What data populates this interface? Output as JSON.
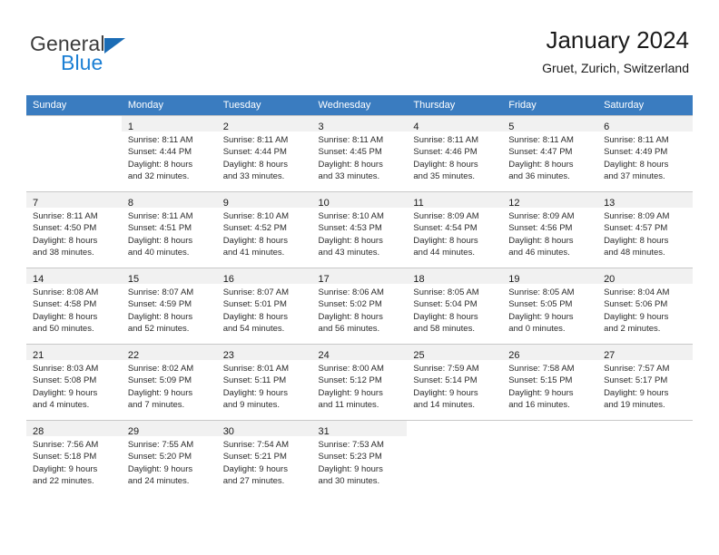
{
  "brand": {
    "line1": "General",
    "line2": "Blue",
    "triangle_color": "#1b6cb5",
    "blue_text_color": "#1b7fd4"
  },
  "header": {
    "title": "January 2024",
    "subtitle": "Gruet, Zurich, Switzerland"
  },
  "theme": {
    "header_row_bg": "#3a7cc0",
    "header_row_text": "#ffffff",
    "daynum_bar_bg": "#f1f1f1",
    "cell_border": "#c8c8c8"
  },
  "weekday_headers": [
    "Sunday",
    "Monday",
    "Tuesday",
    "Wednesday",
    "Thursday",
    "Friday",
    "Saturday"
  ],
  "weeks": [
    [
      {
        "day": "",
        "lines": []
      },
      {
        "day": "1",
        "lines": [
          "Sunrise: 8:11 AM",
          "Sunset: 4:44 PM",
          "Daylight: 8 hours",
          "and 32 minutes."
        ]
      },
      {
        "day": "2",
        "lines": [
          "Sunrise: 8:11 AM",
          "Sunset: 4:44 PM",
          "Daylight: 8 hours",
          "and 33 minutes."
        ]
      },
      {
        "day": "3",
        "lines": [
          "Sunrise: 8:11 AM",
          "Sunset: 4:45 PM",
          "Daylight: 8 hours",
          "and 33 minutes."
        ]
      },
      {
        "day": "4",
        "lines": [
          "Sunrise: 8:11 AM",
          "Sunset: 4:46 PM",
          "Daylight: 8 hours",
          "and 35 minutes."
        ]
      },
      {
        "day": "5",
        "lines": [
          "Sunrise: 8:11 AM",
          "Sunset: 4:47 PM",
          "Daylight: 8 hours",
          "and 36 minutes."
        ]
      },
      {
        "day": "6",
        "lines": [
          "Sunrise: 8:11 AM",
          "Sunset: 4:49 PM",
          "Daylight: 8 hours",
          "and 37 minutes."
        ]
      }
    ],
    [
      {
        "day": "7",
        "lines": [
          "Sunrise: 8:11 AM",
          "Sunset: 4:50 PM",
          "Daylight: 8 hours",
          "and 38 minutes."
        ]
      },
      {
        "day": "8",
        "lines": [
          "Sunrise: 8:11 AM",
          "Sunset: 4:51 PM",
          "Daylight: 8 hours",
          "and 40 minutes."
        ]
      },
      {
        "day": "9",
        "lines": [
          "Sunrise: 8:10 AM",
          "Sunset: 4:52 PM",
          "Daylight: 8 hours",
          "and 41 minutes."
        ]
      },
      {
        "day": "10",
        "lines": [
          "Sunrise: 8:10 AM",
          "Sunset: 4:53 PM",
          "Daylight: 8 hours",
          "and 43 minutes."
        ]
      },
      {
        "day": "11",
        "lines": [
          "Sunrise: 8:09 AM",
          "Sunset: 4:54 PM",
          "Daylight: 8 hours",
          "and 44 minutes."
        ]
      },
      {
        "day": "12",
        "lines": [
          "Sunrise: 8:09 AM",
          "Sunset: 4:56 PM",
          "Daylight: 8 hours",
          "and 46 minutes."
        ]
      },
      {
        "day": "13",
        "lines": [
          "Sunrise: 8:09 AM",
          "Sunset: 4:57 PM",
          "Daylight: 8 hours",
          "and 48 minutes."
        ]
      }
    ],
    [
      {
        "day": "14",
        "lines": [
          "Sunrise: 8:08 AM",
          "Sunset: 4:58 PM",
          "Daylight: 8 hours",
          "and 50 minutes."
        ]
      },
      {
        "day": "15",
        "lines": [
          "Sunrise: 8:07 AM",
          "Sunset: 4:59 PM",
          "Daylight: 8 hours",
          "and 52 minutes."
        ]
      },
      {
        "day": "16",
        "lines": [
          "Sunrise: 8:07 AM",
          "Sunset: 5:01 PM",
          "Daylight: 8 hours",
          "and 54 minutes."
        ]
      },
      {
        "day": "17",
        "lines": [
          "Sunrise: 8:06 AM",
          "Sunset: 5:02 PM",
          "Daylight: 8 hours",
          "and 56 minutes."
        ]
      },
      {
        "day": "18",
        "lines": [
          "Sunrise: 8:05 AM",
          "Sunset: 5:04 PM",
          "Daylight: 8 hours",
          "and 58 minutes."
        ]
      },
      {
        "day": "19",
        "lines": [
          "Sunrise: 8:05 AM",
          "Sunset: 5:05 PM",
          "Daylight: 9 hours",
          "and 0 minutes."
        ]
      },
      {
        "day": "20",
        "lines": [
          "Sunrise: 8:04 AM",
          "Sunset: 5:06 PM",
          "Daylight: 9 hours",
          "and 2 minutes."
        ]
      }
    ],
    [
      {
        "day": "21",
        "lines": [
          "Sunrise: 8:03 AM",
          "Sunset: 5:08 PM",
          "Daylight: 9 hours",
          "and 4 minutes."
        ]
      },
      {
        "day": "22",
        "lines": [
          "Sunrise: 8:02 AM",
          "Sunset: 5:09 PM",
          "Daylight: 9 hours",
          "and 7 minutes."
        ]
      },
      {
        "day": "23",
        "lines": [
          "Sunrise: 8:01 AM",
          "Sunset: 5:11 PM",
          "Daylight: 9 hours",
          "and 9 minutes."
        ]
      },
      {
        "day": "24",
        "lines": [
          "Sunrise: 8:00 AM",
          "Sunset: 5:12 PM",
          "Daylight: 9 hours",
          "and 11 minutes."
        ]
      },
      {
        "day": "25",
        "lines": [
          "Sunrise: 7:59 AM",
          "Sunset: 5:14 PM",
          "Daylight: 9 hours",
          "and 14 minutes."
        ]
      },
      {
        "day": "26",
        "lines": [
          "Sunrise: 7:58 AM",
          "Sunset: 5:15 PM",
          "Daylight: 9 hours",
          "and 16 minutes."
        ]
      },
      {
        "day": "27",
        "lines": [
          "Sunrise: 7:57 AM",
          "Sunset: 5:17 PM",
          "Daylight: 9 hours",
          "and 19 minutes."
        ]
      }
    ],
    [
      {
        "day": "28",
        "lines": [
          "Sunrise: 7:56 AM",
          "Sunset: 5:18 PM",
          "Daylight: 9 hours",
          "and 22 minutes."
        ]
      },
      {
        "day": "29",
        "lines": [
          "Sunrise: 7:55 AM",
          "Sunset: 5:20 PM",
          "Daylight: 9 hours",
          "and 24 minutes."
        ]
      },
      {
        "day": "30",
        "lines": [
          "Sunrise: 7:54 AM",
          "Sunset: 5:21 PM",
          "Daylight: 9 hours",
          "and 27 minutes."
        ]
      },
      {
        "day": "31",
        "lines": [
          "Sunrise: 7:53 AM",
          "Sunset: 5:23 PM",
          "Daylight: 9 hours",
          "and 30 minutes."
        ]
      },
      {
        "day": "",
        "lines": []
      },
      {
        "day": "",
        "lines": []
      },
      {
        "day": "",
        "lines": []
      }
    ]
  ]
}
